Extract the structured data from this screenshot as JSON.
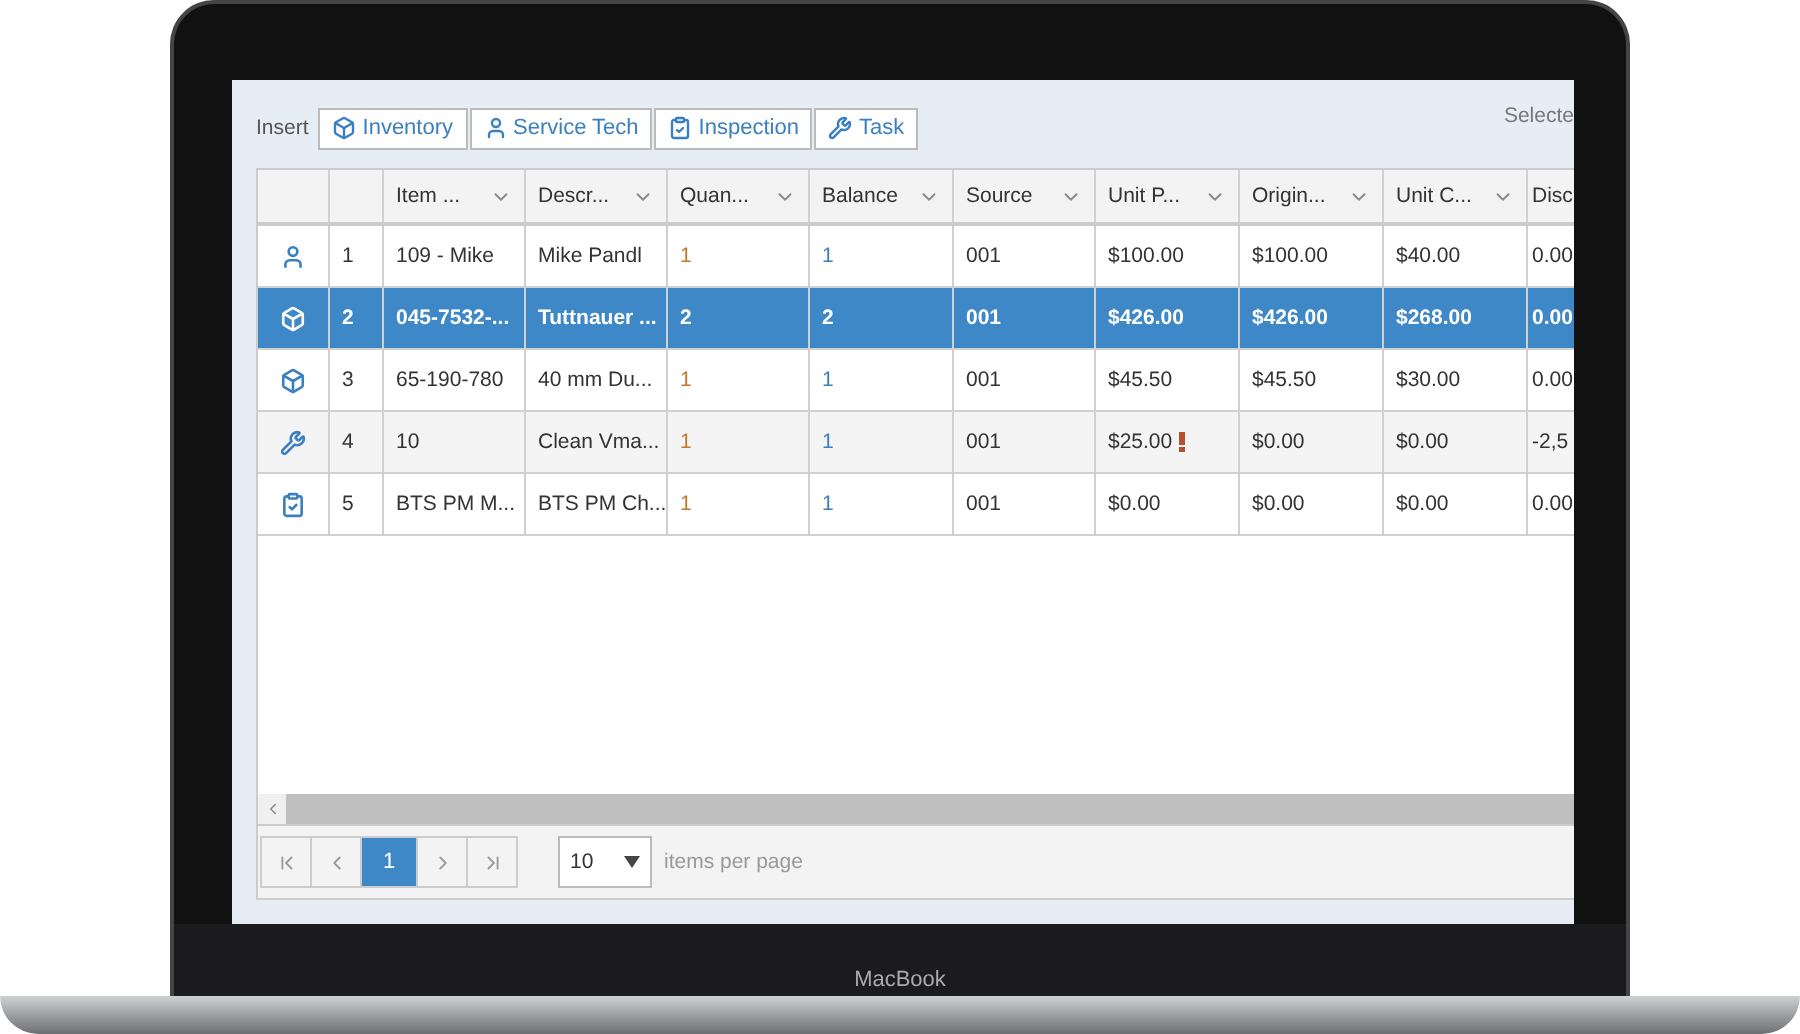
{
  "device": {
    "label": "MacBook"
  },
  "toolbar": {
    "label": "Insert",
    "buttons": [
      {
        "kind": "box",
        "label": "Inventory"
      },
      {
        "kind": "person",
        "label": "Service Tech"
      },
      {
        "kind": "clipboard",
        "label": "Inspection"
      },
      {
        "kind": "tools",
        "label": "Task"
      }
    ],
    "selected_text": "Selecte"
  },
  "table": {
    "columns": [
      "Item ...",
      "Descr...",
      "Quan...",
      "Balance",
      "Source",
      "Unit P...",
      "Origin...",
      "Unit C...",
      "Disc"
    ],
    "rows": [
      {
        "kind": "person",
        "number": "1",
        "selected": false,
        "cells": [
          "109 - Mike",
          "Mike Pandl",
          "1",
          "1",
          "001",
          "$100.00",
          "$100.00",
          "$40.00",
          "0.00"
        ],
        "warning": false
      },
      {
        "kind": "box",
        "number": "2",
        "selected": true,
        "cells": [
          "045-7532-...",
          "Tuttnauer ...",
          "2",
          "2",
          "001",
          "$426.00",
          "$426.00",
          "$268.00",
          "0.00"
        ],
        "warning": false
      },
      {
        "kind": "box",
        "number": "3",
        "selected": false,
        "cells": [
          "65-190-780",
          "40 mm Du...",
          "1",
          "1",
          "001",
          "$45.50",
          "$45.50",
          "$30.00",
          "0.00"
        ],
        "warning": false
      },
      {
        "kind": "tools",
        "number": "4",
        "selected": false,
        "cells": [
          "10",
          "Clean Vma...",
          "1",
          "1",
          "001",
          "$25.00",
          "$0.00",
          "$0.00",
          "-2,5"
        ],
        "warning": true
      },
      {
        "kind": "clipboard",
        "number": "5",
        "selected": false,
        "cells": [
          "BTS PM M...",
          "BTS PM Ch...",
          "1",
          "1",
          "001",
          "$0.00",
          "$0.00",
          "$0.00",
          "0.00"
        ],
        "warning": false
      }
    ]
  },
  "pager": {
    "pages": [
      {
        "label": "1",
        "selected": true
      }
    ],
    "page_size": "10",
    "page_size_label": "items per page"
  }
}
